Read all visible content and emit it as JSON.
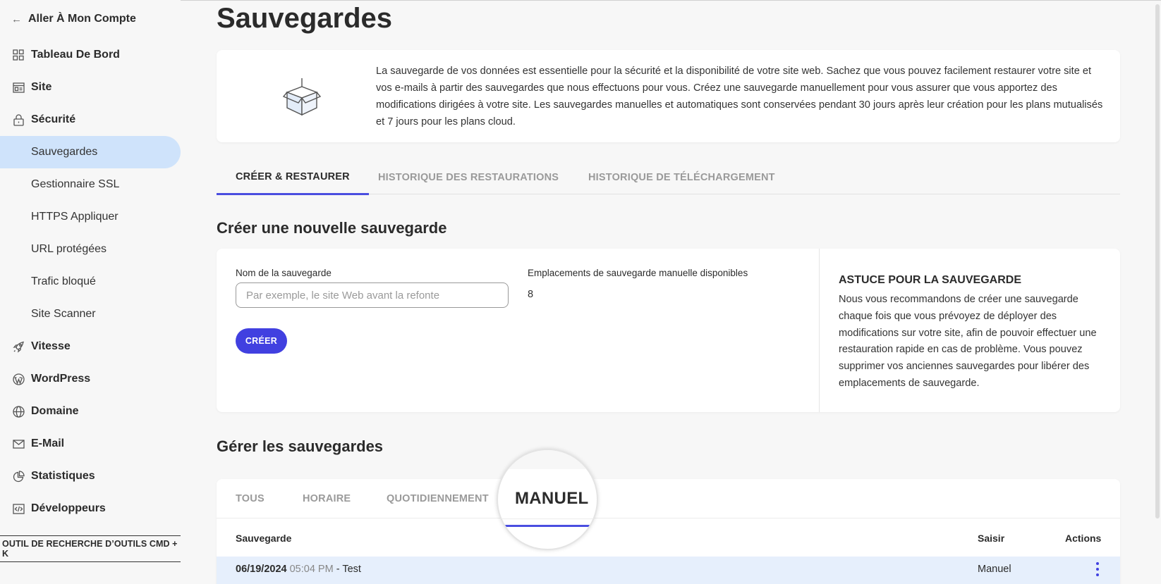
{
  "sidebar": {
    "back_label": "Aller À Mon Compte",
    "items": [
      {
        "label": "Tableau De Bord",
        "icon": "dashboard-icon"
      },
      {
        "label": "Site",
        "icon": "site-icon"
      },
      {
        "label": "Sécurité",
        "icon": "lock-icon"
      },
      {
        "label": "Sauvegardes"
      },
      {
        "label": "Gestionnaire SSL"
      },
      {
        "label": "HTTPS Appliquer"
      },
      {
        "label": "URL protégées"
      },
      {
        "label": "Trafic bloqué"
      },
      {
        "label": "Site Scanner"
      },
      {
        "label": "Vitesse",
        "icon": "rocket-icon"
      },
      {
        "label": "WordPress",
        "icon": "wordpress-icon"
      },
      {
        "label": "Domaine",
        "icon": "globe-icon"
      },
      {
        "label": "E-Mail",
        "icon": "mail-icon"
      },
      {
        "label": "Statistiques",
        "icon": "chart-icon"
      },
      {
        "label": "Développeurs",
        "icon": "code-icon"
      }
    ],
    "tool_search": "OUTIL DE RECHERCHE D’OUTILS CMD + K"
  },
  "main": {
    "title": "Sauvegardes",
    "info_text": "La sauvegarde de vos données est essentielle pour la sécurité et la disponibilité de votre site web. Sachez que vous pouvez facilement restaurer votre site et vos e-mails à partir des sauvegardes que nous effectuons pour vous. Créez une sauvegarde manuellement pour vous assurer que vous apportez des modifications dirigées à votre site. Les sauvegardes manuelles et automatiques sont conservées pendant 30 jours après leur création pour les plans mutualisés et 7 jours pour les plans cloud.",
    "tabs": [
      "CRÉER & RESTAURER",
      "HISTORIQUE DES RESTAURATIONS",
      "HISTORIQUE DE TÉLÉCHARGEMENT"
    ],
    "create_title": "Créer une nouvelle sauvegarde",
    "name_label": "Nom de la sauvegarde",
    "name_placeholder": "Par exemple, le site Web avant la refonte",
    "slots_label": "Emplacements de sauvegarde manuelle disponibles",
    "slots_value": "8",
    "create_button": "CRÉER",
    "tip_title": "ASTUCE POUR LA SAUVEGARDE",
    "tip_text": "Nous vous recommandons de créer une sauvegarde chaque fois que vous prévoyez de déployer des modifications sur votre site, afin de pouvoir effectuer une restauration rapide en cas de problème. Vous pouvez supprimer vos anciennes sauvegardes pour libérer des emplacements de sauvegarde.",
    "manage_title": "Gérer les sauvegardes",
    "filter_tabs": [
      "TOUS",
      "HORAIRE",
      "QUOTIDIENNEMENT",
      "MANUEL"
    ],
    "table_headers": {
      "backup": "Sauvegarde",
      "type": "Saisir",
      "actions": "Actions"
    },
    "rows": [
      {
        "date": "06/19/2024",
        "time": "05:04 PM",
        "name": "- Test",
        "type": "Manuel"
      }
    ]
  },
  "colors": {
    "accent": "#4140e0",
    "active_nav": "#cfe3fb",
    "row_highlight": "#e6effc"
  }
}
